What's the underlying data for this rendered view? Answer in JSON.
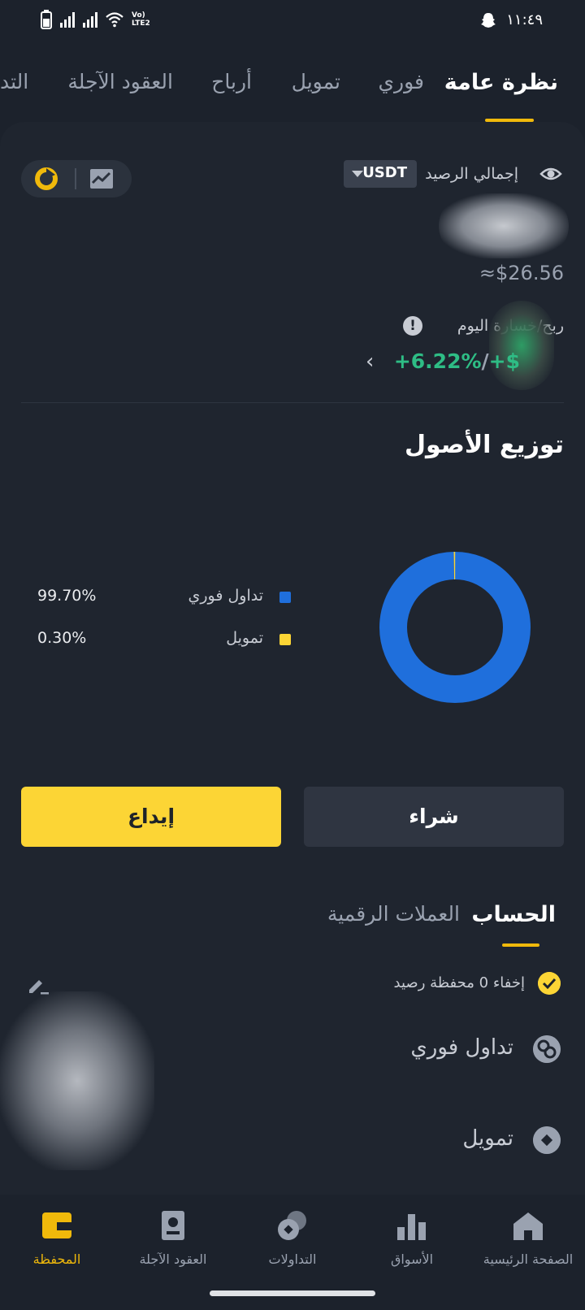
{
  "status_bar": {
    "time": "١١:٤٩",
    "network": "Vo) LTE2"
  },
  "top_tabs": [
    {
      "label": "نظرة عامة",
      "active": true
    },
    {
      "label": "فوري"
    },
    {
      "label": "تمويل"
    },
    {
      "label": "أرباح"
    },
    {
      "label": "العقود الآجلة"
    },
    {
      "label": "التد"
    }
  ],
  "balance": {
    "label": "إجمالي الرصيد",
    "currency": "USDT",
    "fiat_value": "≈$26.56"
  },
  "pnl": {
    "label": "ربح/خسارة اليوم",
    "percent": "+6.22%",
    "prefix": "+$"
  },
  "distribution": {
    "title": "توزيع الأصول",
    "legend": [
      {
        "name": "تداول فوري",
        "percent": "99.70%",
        "color": "#1f6fdc"
      },
      {
        "name": "تمويل",
        "percent": "0.30%",
        "color": "#fcd535"
      }
    ]
  },
  "chart_data": {
    "type": "pie",
    "title": "توزيع الأصول",
    "categories": [
      "تداول فوري",
      "تمويل"
    ],
    "values": [
      99.7,
      0.3
    ],
    "colors": [
      "#1f6fdc",
      "#fcd535"
    ]
  },
  "actions": {
    "deposit": "إيداع",
    "buy": "شراء"
  },
  "sub_tabs": [
    {
      "label": "الحساب",
      "active": true
    },
    {
      "label": "العملات الرقمية"
    }
  ],
  "hide_zero": "إخفاء 0 محفظة رصيد",
  "accounts": [
    {
      "label": "تداول فوري",
      "icon": "spot-icon"
    },
    {
      "label": "تمويل",
      "icon": "funding-icon"
    }
  ],
  "bottom_nav": [
    {
      "label": "الصفحة الرئيسية",
      "icon": "home-icon"
    },
    {
      "label": "الأسواق",
      "icon": "markets-icon"
    },
    {
      "label": "التداولات",
      "icon": "trades-icon"
    },
    {
      "label": "العقود الآجلة",
      "icon": "futures-icon"
    },
    {
      "label": "المحفظة",
      "icon": "wallet-icon",
      "active": true
    }
  ],
  "colors": {
    "accent": "#f0b90b",
    "positive": "#2ebd85",
    "background": "#1c222c"
  }
}
